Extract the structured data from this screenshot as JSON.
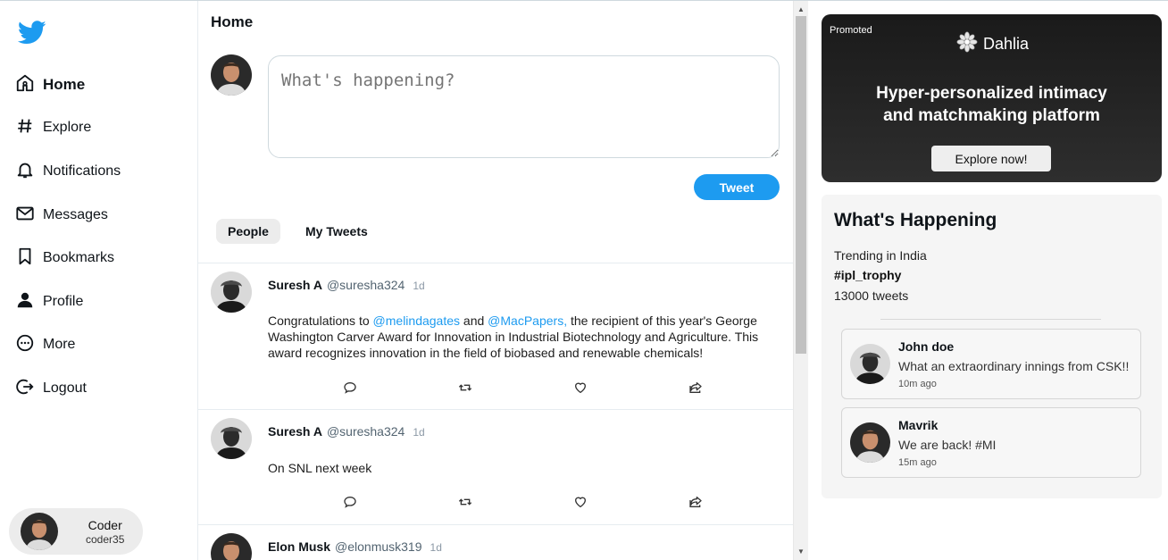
{
  "colors": {
    "accent": "#1d9bf0",
    "twitter_blue": "#1d9bf0",
    "promo_bg": "#222222"
  },
  "sidebar": {
    "logo": "twitter-bird-icon",
    "items": [
      {
        "label": "Home",
        "icon": "home-icon",
        "active": true
      },
      {
        "label": "Explore",
        "icon": "hashtag-icon"
      },
      {
        "label": "Notifications",
        "icon": "bell-icon"
      },
      {
        "label": "Messages",
        "icon": "envelope-icon"
      },
      {
        "label": "Bookmarks",
        "icon": "bookmark-icon"
      },
      {
        "label": "Profile",
        "icon": "person-icon"
      },
      {
        "label": "More",
        "icon": "more-circle-icon"
      },
      {
        "label": "Logout",
        "icon": "logout-icon"
      }
    ],
    "user": {
      "name": "Coder",
      "handle": "coder35"
    }
  },
  "feed": {
    "title": "Home",
    "compose_placeholder": "What's happening?",
    "tweet_button": "Tweet",
    "tabs": [
      {
        "label": "People",
        "active": true
      },
      {
        "label": "My Tweets"
      }
    ],
    "tweets": [
      {
        "name": "Suresh A",
        "handle": "@suresha324",
        "time": "1d",
        "text_1": "Congratulations to ",
        "mention_1": "@melindagates",
        "text_2": " and ",
        "mention_2": "@MacPapers,",
        "text_3": " the recipient of this year's George Washington Carver Award for Innovation in Industrial Biotechnology and Agriculture. This award recognizes innovation in the field of biobased and renewable chemicals!"
      },
      {
        "name": "Suresh A",
        "handle": "@suresha324",
        "time": "1d",
        "text": "On SNL next week"
      },
      {
        "name": "Elon Musk",
        "handle": "@elonmusk319",
        "time": "1d"
      }
    ]
  },
  "promo": {
    "badge": "Promoted",
    "brand": "Dahlia",
    "headline_line1": "Hyper-personalized intimacy",
    "headline_line2": "and matchmaking platform",
    "cta": "Explore now!"
  },
  "happening": {
    "title": "What's Happening",
    "location": "Trending in India",
    "hashtag": "#ipl_trophy",
    "count": "13000 tweets",
    "items": [
      {
        "name": "John doe",
        "text": "What an extraordinary innings from CSK!!",
        "time": "10m ago"
      },
      {
        "name": "Mavrik",
        "text": "We are back! #MI",
        "time": "15m ago"
      }
    ]
  }
}
